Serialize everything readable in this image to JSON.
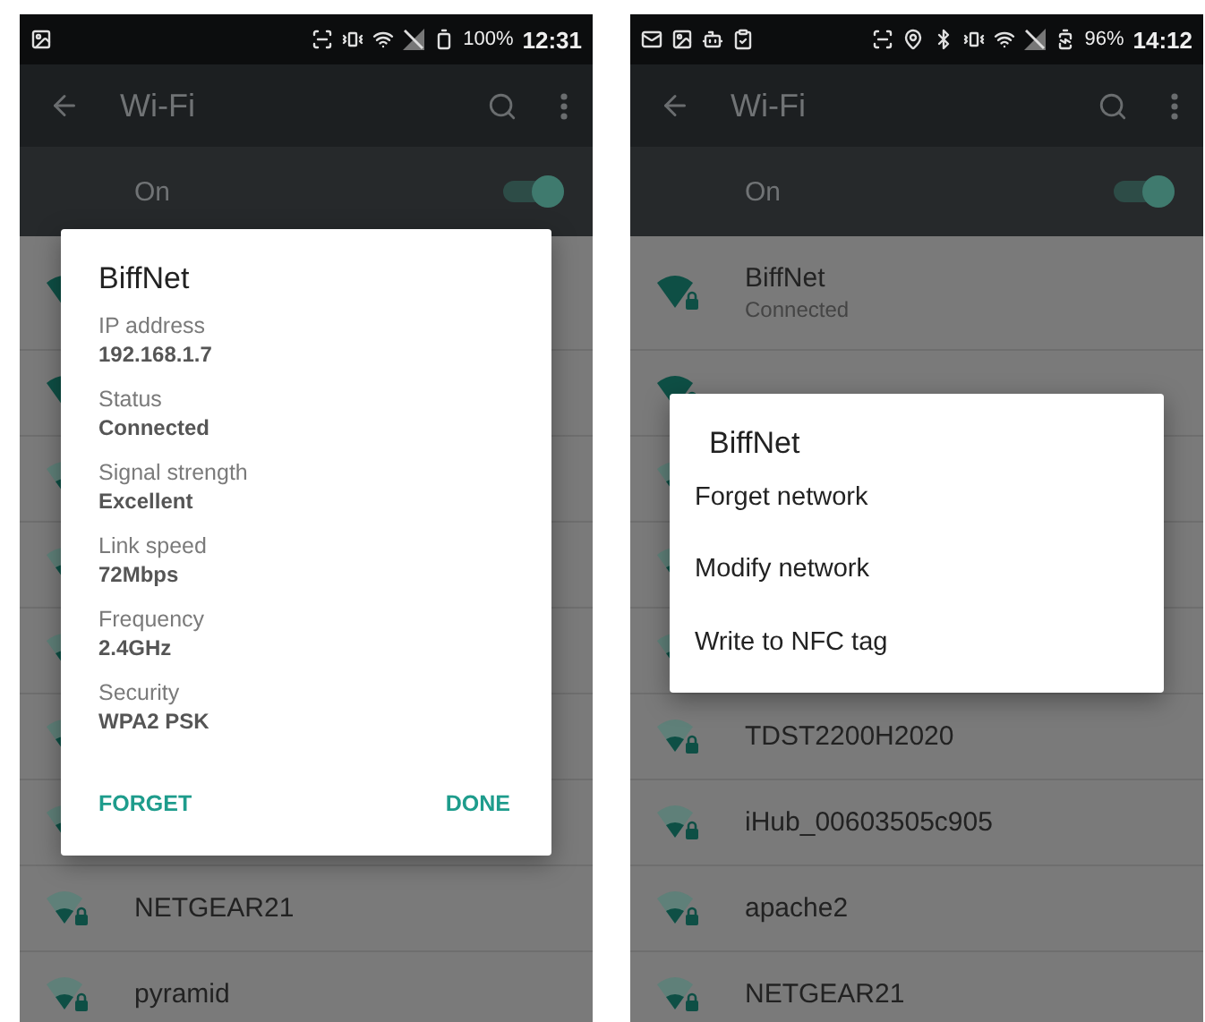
{
  "phones": [
    {
      "status_bar": {
        "notification_icons": [
          {
            "kind": "image"
          }
        ],
        "system_icons": [
          {
            "kind": "scan"
          },
          {
            "kind": "vibrate"
          },
          {
            "kind": "wifi"
          },
          {
            "kind": "no-signal"
          },
          {
            "kind": "battery"
          }
        ],
        "battery": "100%",
        "time": "12:31"
      },
      "toolbar": {
        "title": "Wi-Fi"
      },
      "wifi_switch": {
        "label": "On",
        "on": true
      },
      "networks": [
        {
          "full_signal": true
        },
        {
          "full_signal": true
        },
        {
          "full_signal": false
        },
        {
          "full_signal": false
        },
        {
          "full_signal": false
        },
        {
          "full_signal": false
        },
        {
          "full_signal": false
        },
        {
          "name": "NETGEAR21",
          "full_signal": false
        },
        {
          "name": "pyramid",
          "full_signal": false
        }
      ],
      "dialog": {
        "kind": "details",
        "title": "BiffNet",
        "fields": [
          {
            "label": "IP address",
            "value": "192.168.1.7"
          },
          {
            "label": "Status",
            "value": "Connected"
          },
          {
            "label": "Signal strength",
            "value": "Excellent"
          },
          {
            "label": "Link speed",
            "value": "72Mbps"
          },
          {
            "label": "Frequency",
            "value": "2.4GHz"
          },
          {
            "label": "Security",
            "value": "WPA2 PSK"
          }
        ],
        "buttons": [
          {
            "label": "FORGET"
          },
          {
            "label": "DONE"
          }
        ]
      }
    },
    {
      "status_bar": {
        "notification_icons": [
          {
            "kind": "mail"
          },
          {
            "kind": "image"
          },
          {
            "kind": "android"
          },
          {
            "kind": "clipboard"
          }
        ],
        "system_icons": [
          {
            "kind": "scan"
          },
          {
            "kind": "location"
          },
          {
            "kind": "bluetooth"
          },
          {
            "kind": "vibrate"
          },
          {
            "kind": "wifi"
          },
          {
            "kind": "no-signal"
          },
          {
            "kind": "battery-charging"
          }
        ],
        "battery": "96%",
        "time": "14:12"
      },
      "toolbar": {
        "title": "Wi-Fi"
      },
      "wifi_switch": {
        "label": "On",
        "on": true
      },
      "networks": [
        {
          "name": "BiffNet",
          "status": "Connected",
          "full_signal": true
        },
        {
          "full_signal": true
        },
        {
          "full_signal": false
        },
        {
          "full_signal": false
        },
        {
          "full_signal": false
        },
        {
          "name": "TDST2200H2020",
          "full_signal": false
        },
        {
          "name": "iHub_00603505c905",
          "full_signal": false
        },
        {
          "name": "apache2",
          "full_signal": false
        },
        {
          "name": "NETGEAR21",
          "full_signal": false
        }
      ],
      "dialog": {
        "kind": "menu",
        "title": "BiffNet",
        "items": [
          "Forget network",
          "Modify network",
          "Write to NFC tag"
        ]
      }
    }
  ]
}
